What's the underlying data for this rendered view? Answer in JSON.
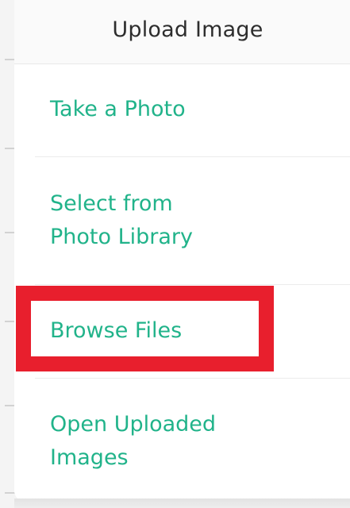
{
  "sheet": {
    "title": "Upload Image",
    "options": [
      {
        "id": "take-photo",
        "label": "Take a Photo"
      },
      {
        "id": "photo-library",
        "label": "Select from\nPhoto Library"
      },
      {
        "id": "browse-files",
        "label": "Browse Files"
      },
      {
        "id": "uploaded-images",
        "label": "Open Uploaded\nImages"
      }
    ]
  },
  "colors": {
    "accent": "#21b38a",
    "highlight": "#e81f2d",
    "title": "#2d2d2d"
  }
}
